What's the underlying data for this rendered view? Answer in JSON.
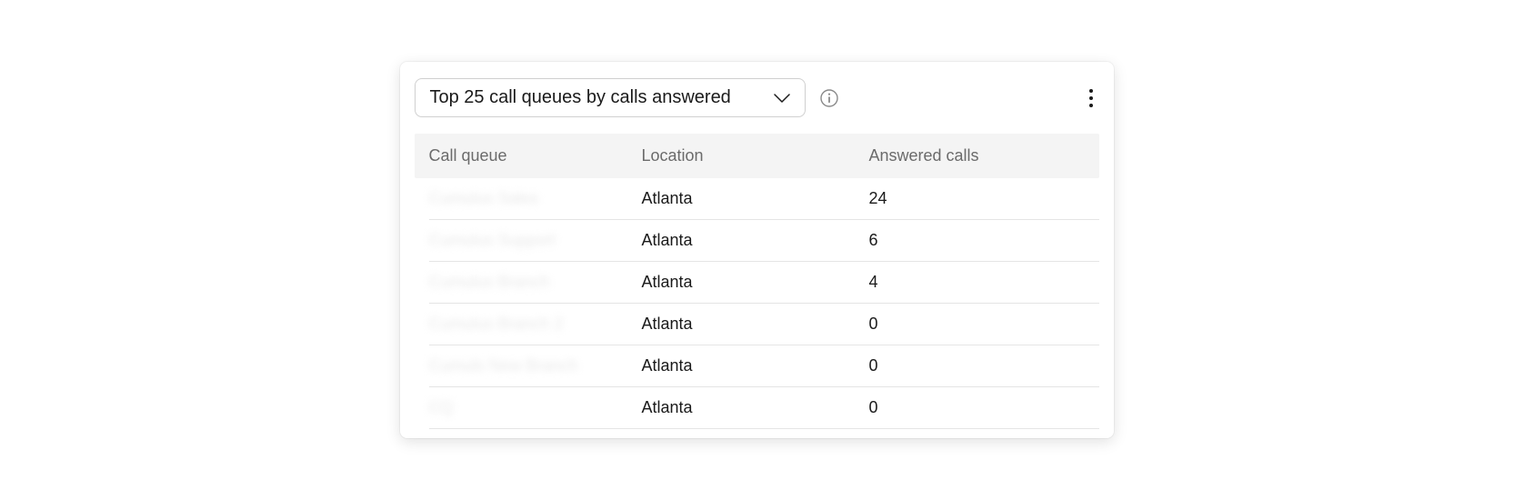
{
  "header": {
    "dropdown_label": "Top 25 call queues by calls answered"
  },
  "table": {
    "columns": {
      "queue": "Call queue",
      "location": "Location",
      "answered": "Answered calls"
    },
    "rows": [
      {
        "queue": "Cumulus Sales",
        "location": "Atlanta",
        "answered": "24"
      },
      {
        "queue": "Cumulus Support",
        "location": "Atlanta",
        "answered": "6"
      },
      {
        "queue": "Cumulus Branch",
        "location": "Atlanta",
        "answered": "4"
      },
      {
        "queue": "Cumulus Branch 2",
        "location": "Atlanta",
        "answered": "0"
      },
      {
        "queue": "Cumuls New Branch",
        "location": "Atlanta",
        "answered": "0"
      },
      {
        "queue": "CQ",
        "location": "Atlanta",
        "answered": "0"
      }
    ]
  }
}
